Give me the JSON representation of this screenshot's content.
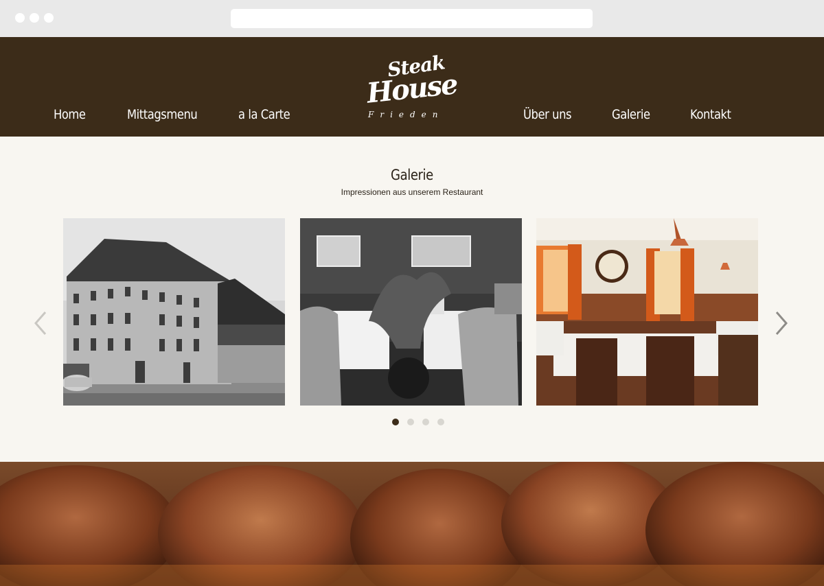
{
  "nav": {
    "left": [
      "Home",
      "Mittagsmenu",
      "a la Carte"
    ],
    "right": [
      "Über uns",
      "Galerie",
      "Kontakt"
    ]
  },
  "logo": {
    "line1": "Steak",
    "line2": "House",
    "line3": "Frieden"
  },
  "gallery": {
    "title": "Galerie",
    "subtitle": "Impressionen aus unserem Restaurant",
    "slide_count": 4,
    "active_slide": 1
  },
  "colors": {
    "header_bg": "#3c2c19",
    "section_bg": "#f8f6f1",
    "active_dot": "#3c2c19",
    "inactive_dot": "#d8d6d0"
  }
}
